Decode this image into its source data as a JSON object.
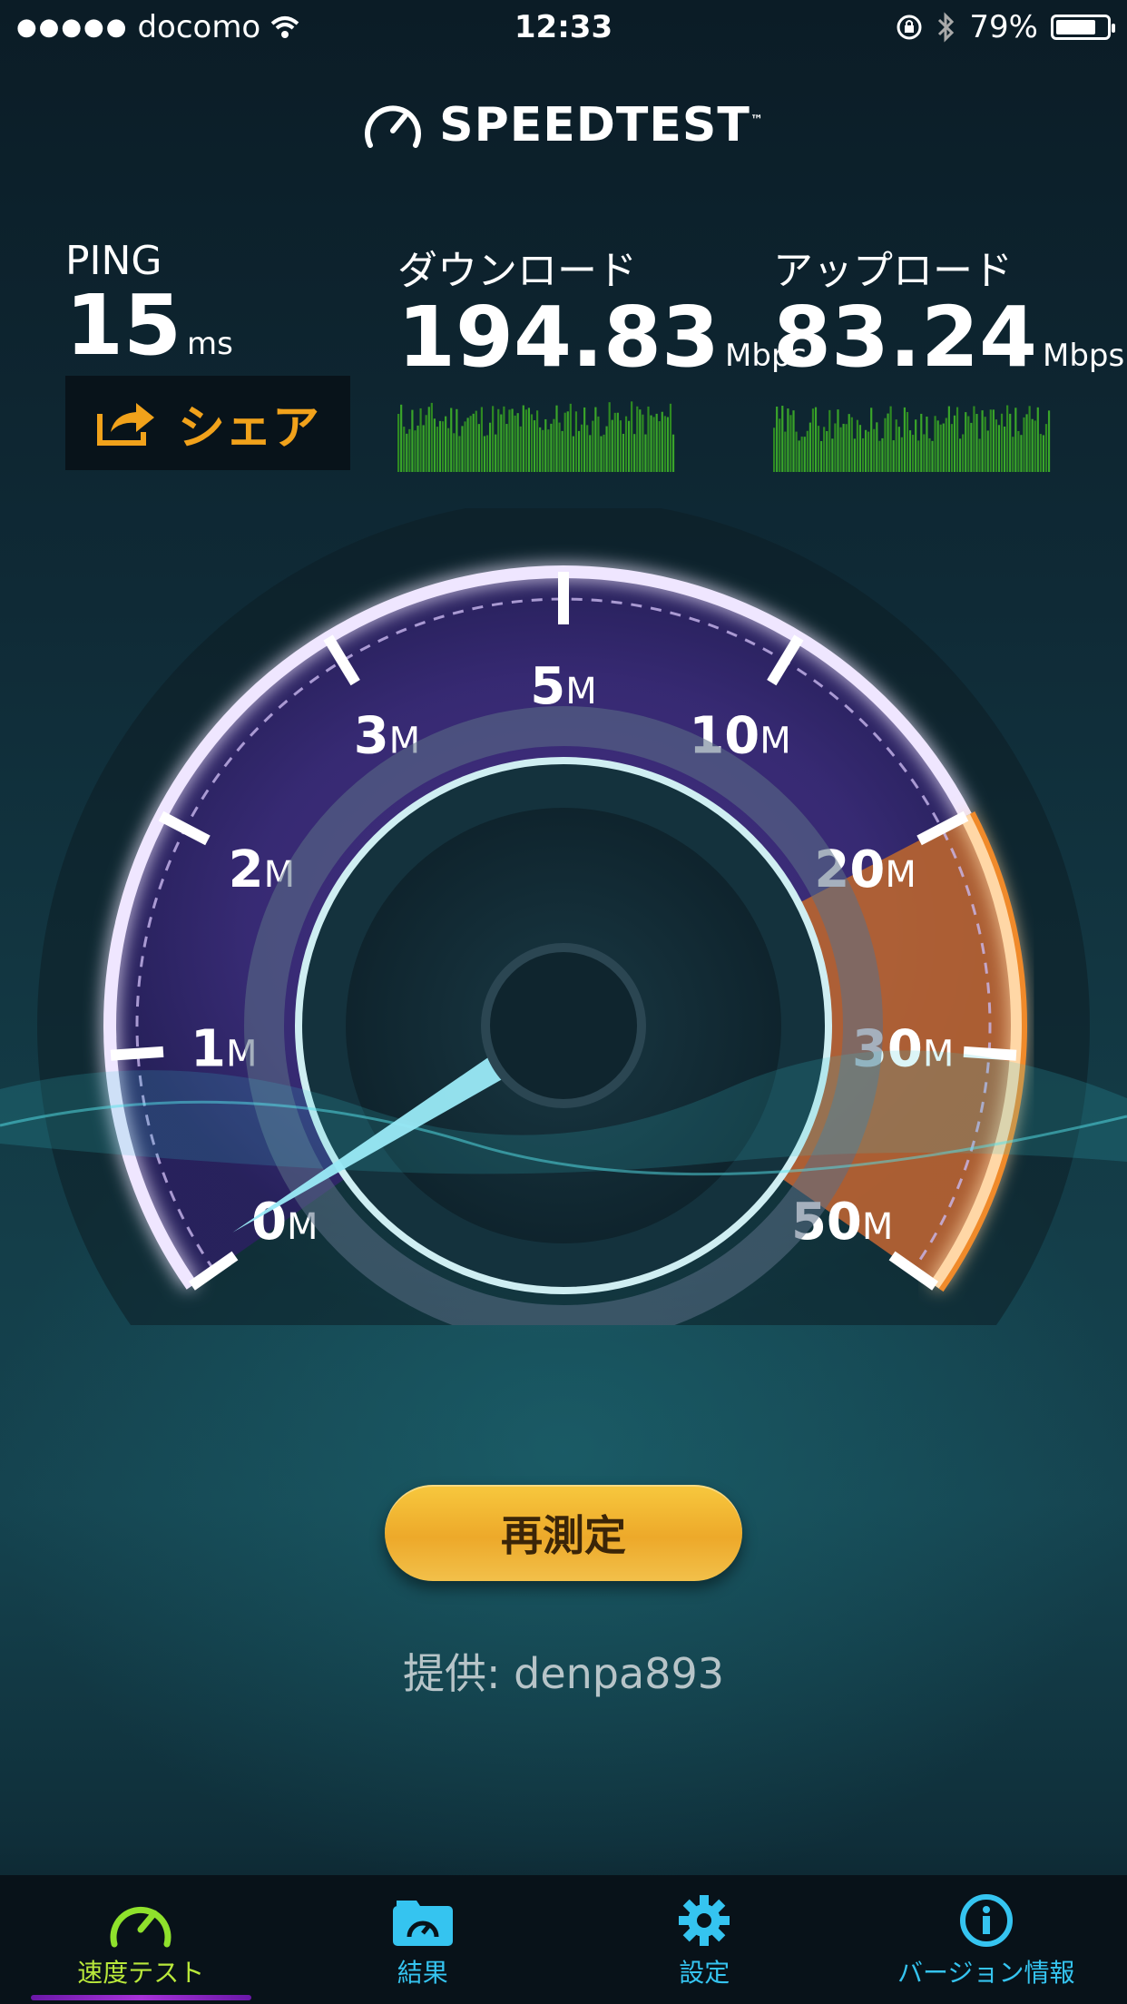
{
  "status_bar": {
    "carrier": "docomo",
    "time": "12:33",
    "battery": "79%",
    "battery_level": 0.79
  },
  "app": {
    "title": "SPEEDTEST",
    "tm": "™"
  },
  "results": {
    "ping": {
      "label": "PING",
      "value": "15",
      "unit": "ms"
    },
    "download": {
      "label": "ダウンロード",
      "value": "194.83",
      "unit": "Mbps"
    },
    "upload": {
      "label": "アップロード",
      "value": "83.24",
      "unit": "Mbps"
    }
  },
  "share": {
    "label": "シェア"
  },
  "gauge": {
    "ticks": [
      {
        "num": "0",
        "unit": "M"
      },
      {
        "num": "1",
        "unit": "M"
      },
      {
        "num": "2",
        "unit": "M"
      },
      {
        "num": "3",
        "unit": "M"
      },
      {
        "num": "5",
        "unit": "M"
      },
      {
        "num": "10",
        "unit": "M"
      },
      {
        "num": "20",
        "unit": "M"
      },
      {
        "num": "30",
        "unit": "M"
      },
      {
        "num": "50",
        "unit": "M"
      }
    ],
    "colors": {
      "track": "#7b4fd0",
      "high": "#f08a2a"
    }
  },
  "actions": {
    "retest": "再測定"
  },
  "provider": {
    "text": "提供: denpa893"
  },
  "tabs": [
    {
      "label": "速度テスト",
      "icon": "speedometer-icon",
      "active": true
    },
    {
      "label": "結果",
      "icon": "folder-gauge-icon",
      "active": false
    },
    {
      "label": "設定",
      "icon": "gear-icon",
      "active": false
    },
    {
      "label": "バージョン情報",
      "icon": "info-icon",
      "active": false
    }
  ]
}
